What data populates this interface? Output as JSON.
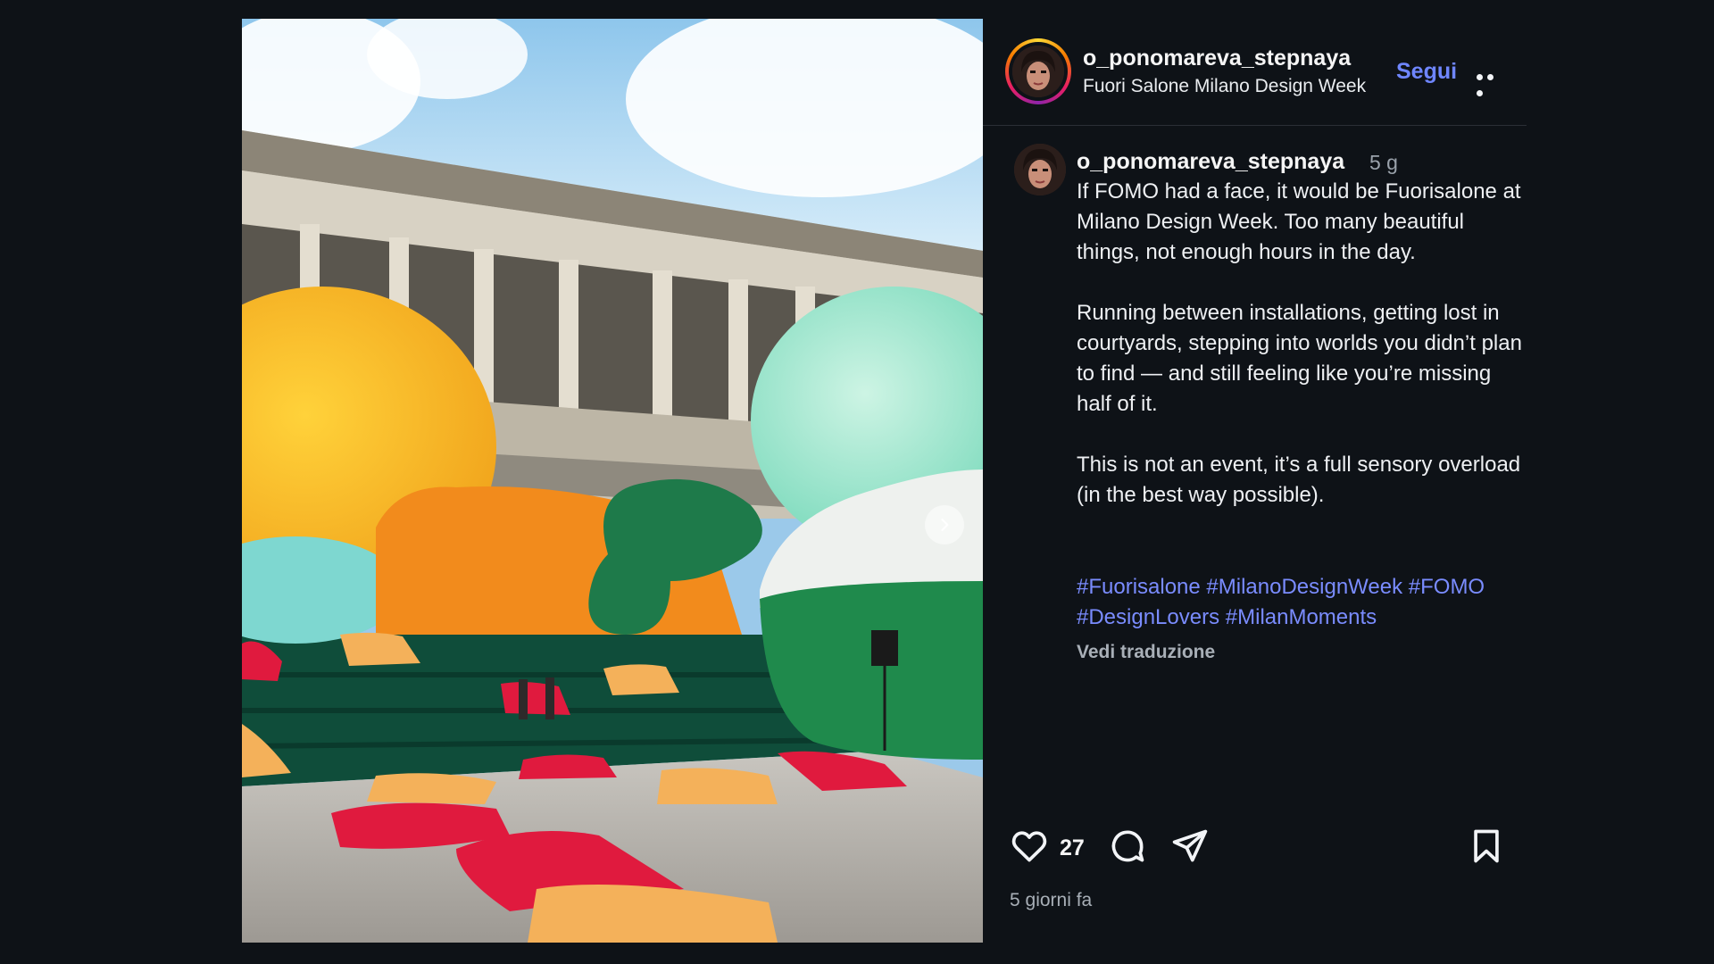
{
  "post": {
    "username": "o_ponomareva_stepnaya",
    "location": "Fuori Salone Milano Design Week",
    "follow_label": "Segui",
    "more_icon": "more-horizontal-icon",
    "image_alt": "Inflatable installations in a courtyard at Fuorisalone, Milano Design Week"
  },
  "caption": {
    "username": "o_ponomareva_stepnaya",
    "time": "5 g",
    "paragraphs": [
      "If FOMO had a face, it would be Fuorisalone at Milano Design Week. Too many beautiful things, not enough hours in the day.",
      "Running between installations, getting lost in courtyards, stepping into worlds you didn’t plan to find — and still feeling like you’re missing half of it.",
      "This is not an event, it’s a full sensory overload (in the best way possible)."
    ],
    "hashtags": [
      "#Fuorisalone",
      "#MilanoDesignWeek",
      "#FOMO",
      "#DesignLovers",
      "#MilanMoments"
    ],
    "translate_label": "Vedi traduzione"
  },
  "actions": {
    "like_count": "27",
    "icons": [
      "heart-icon",
      "comment-icon",
      "share-icon",
      "bookmark-icon"
    ]
  },
  "footer": {
    "date_ago": "5 giorni fa"
  },
  "colors": {
    "background": "#0e1217",
    "link": "#6f86ff",
    "hashtag": "#7a8cff"
  }
}
